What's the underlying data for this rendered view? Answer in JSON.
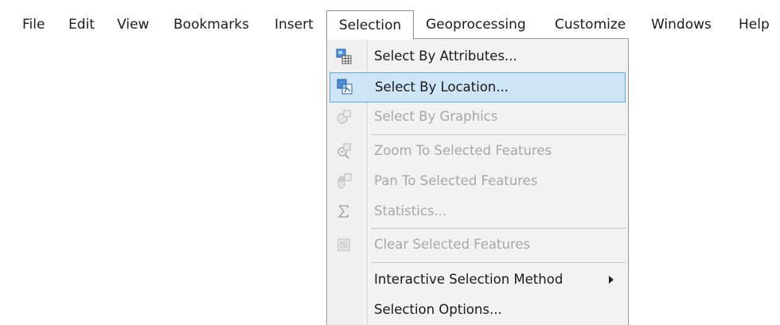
{
  "menubar": {
    "items": [
      {
        "label": "File"
      },
      {
        "label": "Edit"
      },
      {
        "label": "View"
      },
      {
        "label": "Bookmarks"
      },
      {
        "label": "Insert"
      },
      {
        "label": "Selection",
        "active": true
      },
      {
        "label": "Geoprocessing"
      },
      {
        "label": "Customize"
      },
      {
        "label": "Windows"
      },
      {
        "label": "Help"
      }
    ]
  },
  "selection_menu": {
    "items": [
      {
        "label": "Select By Attributes...",
        "icon": "select-by-attributes-icon",
        "enabled": true
      },
      {
        "label": "Select By Location...",
        "icon": "select-by-location-icon",
        "enabled": true,
        "highlighted": true
      },
      {
        "label": "Select By Graphics",
        "icon": "select-by-graphics-icon",
        "enabled": false
      },
      {
        "label": "Zoom To Selected Features",
        "icon": "zoom-to-selected-icon",
        "enabled": false
      },
      {
        "label": "Pan To Selected Features",
        "icon": "pan-to-selected-icon",
        "enabled": false
      },
      {
        "label": "Statistics...",
        "icon": "sigma-icon",
        "enabled": false
      },
      {
        "label": "Clear Selected Features",
        "icon": "clear-selection-icon",
        "enabled": false
      },
      {
        "label": "Interactive Selection Method",
        "enabled": true,
        "has_submenu": true
      },
      {
        "label": "Selection Options...",
        "enabled": true
      }
    ]
  },
  "colors": {
    "highlight_fill": "#cde5f7",
    "highlight_border": "#6aa6d8",
    "disabled_text": "#a7a7a7"
  }
}
